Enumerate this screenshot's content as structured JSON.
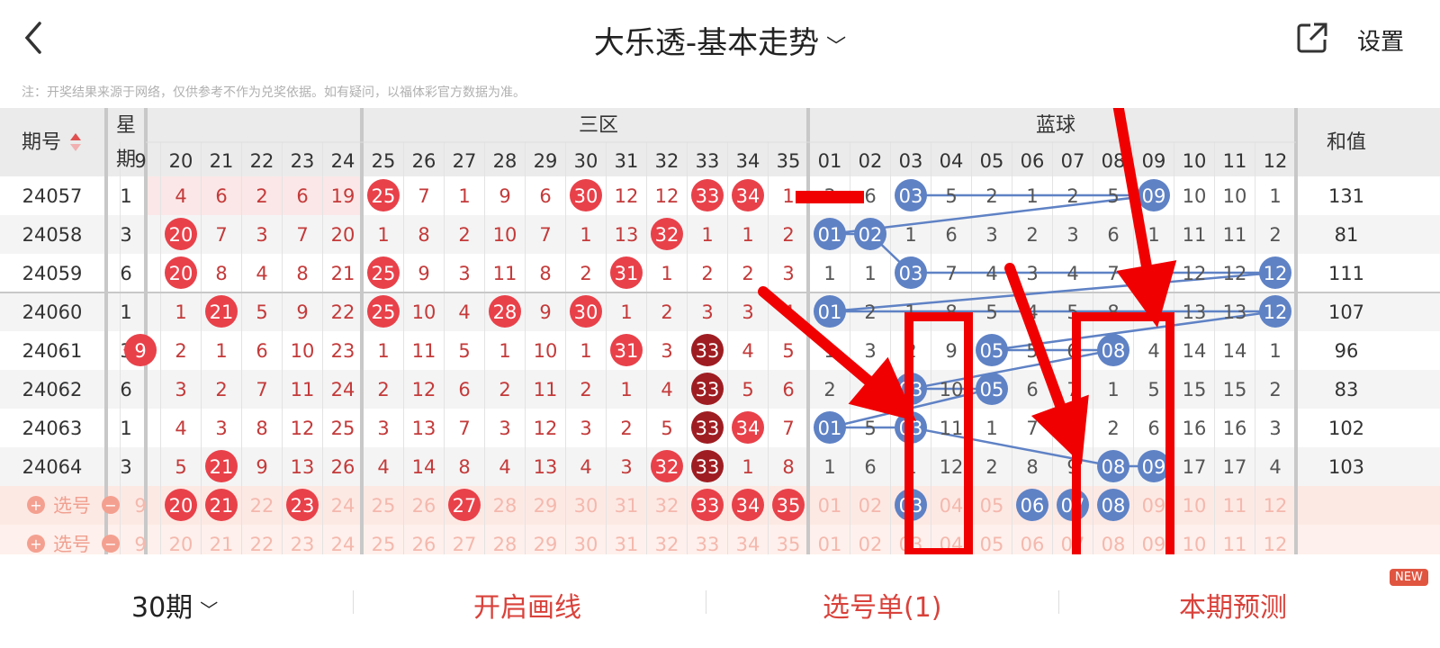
{
  "header": {
    "title": "大乐透-基本走势",
    "settings": "设置"
  },
  "note": "注：开奖结果来源于网络，仅供参考不作为兑奖依据。如有疑问，以福体彩官方数据为准。",
  "table": {
    "period_header": "期号",
    "weekday_header": "星期",
    "sanqu_header": "三区",
    "blue_header": "蓝球",
    "sum_header": "和值",
    "pick_label": "选号",
    "red_numbers": [
      "9",
      "20",
      "21",
      "22",
      "23",
      "24",
      "25",
      "26",
      "27",
      "28",
      "29",
      "30",
      "31",
      "32",
      "33",
      "34",
      "35"
    ],
    "blue_numbers": [
      "01",
      "02",
      "03",
      "04",
      "05",
      "06",
      "07",
      "08",
      "09",
      "10",
      "11",
      "12"
    ],
    "rows": [
      {
        "period": "24057",
        "week": "1",
        "red": [
          "",
          "4",
          "6",
          "2",
          "6",
          "19",
          "25",
          "7",
          "1",
          "9",
          "6",
          "30",
          "12",
          "12",
          "33",
          "34",
          "1"
        ],
        "blue": [
          "3",
          "6",
          "03",
          "5",
          "2",
          "1",
          "2",
          "5",
          "09",
          "10",
          "10",
          "1"
        ],
        "sum": "131"
      },
      {
        "period": "24058",
        "week": "3",
        "red": [
          "",
          "20",
          "7",
          "3",
          "7",
          "20",
          "1",
          "8",
          "2",
          "10",
          "7",
          "1",
          "13",
          "32",
          "1",
          "1",
          "2"
        ],
        "blue": [
          "01",
          "02",
          "1",
          "6",
          "3",
          "2",
          "3",
          "6",
          "1",
          "11",
          "11",
          "2"
        ],
        "sum": "81"
      },
      {
        "period": "24059",
        "week": "6",
        "red": [
          "",
          "20",
          "8",
          "4",
          "8",
          "21",
          "25",
          "9",
          "3",
          "11",
          "8",
          "2",
          "31",
          "1",
          "2",
          "2",
          "3"
        ],
        "blue": [
          "1",
          "1",
          "03",
          "7",
          "4",
          "3",
          "4",
          "7",
          "2",
          "12",
          "12",
          "12"
        ],
        "sum": "111"
      },
      {
        "period": "24060",
        "week": "1",
        "red": [
          "",
          "1",
          "21",
          "5",
          "9",
          "22",
          "25",
          "10",
          "4",
          "28",
          "9",
          "30",
          "1",
          "2",
          "3",
          "3",
          "4"
        ],
        "blue": [
          "01",
          "2",
          "1",
          "8",
          "5",
          "4",
          "5",
          "8",
          "3",
          "13",
          "13",
          "12"
        ],
        "sum": "107"
      },
      {
        "period": "24061",
        "week": "3",
        "red": [
          "9",
          "2",
          "1",
          "6",
          "10",
          "23",
          "1",
          "11",
          "5",
          "1",
          "10",
          "1",
          "31",
          "3",
          "33",
          "4",
          "5"
        ],
        "blue": [
          "1",
          "3",
          "2",
          "9",
          "05",
          "5",
          "6",
          "08",
          "4",
          "14",
          "14",
          "1"
        ],
        "sum": "96"
      },
      {
        "period": "24062",
        "week": "6",
        "red": [
          "",
          "3",
          "2",
          "7",
          "11",
          "24",
          "2",
          "12",
          "6",
          "2",
          "11",
          "2",
          "1",
          "4",
          "33",
          "5",
          "6"
        ],
        "blue": [
          "2",
          "4",
          "03",
          "10",
          "05",
          "6",
          "7",
          "1",
          "5",
          "15",
          "15",
          "2"
        ],
        "sum": "83"
      },
      {
        "period": "24063",
        "week": "1",
        "red": [
          "",
          "4",
          "3",
          "8",
          "12",
          "25",
          "3",
          "13",
          "7",
          "3",
          "12",
          "3",
          "2",
          "5",
          "33",
          "34",
          "7"
        ],
        "blue": [
          "01",
          "5",
          "03",
          "11",
          "1",
          "7",
          "8",
          "2",
          "6",
          "16",
          "16",
          "3"
        ],
        "sum": "102"
      },
      {
        "period": "24064",
        "week": "3",
        "red": [
          "",
          "5",
          "21",
          "9",
          "13",
          "26",
          "4",
          "14",
          "8",
          "4",
          "13",
          "4",
          "3",
          "32",
          "33",
          "1",
          "8"
        ],
        "blue": [
          "1",
          "6",
          "1",
          "12",
          "2",
          "8",
          "9",
          "08",
          "09",
          "17",
          "17",
          "4"
        ],
        "sum": "103"
      }
    ],
    "ball_cells": {
      "0": {
        "red": [
          6,
          11,
          14,
          15
        ],
        "blue": [
          2,
          8
        ]
      },
      "1": {
        "red": [
          1,
          13
        ],
        "blue": [
          0,
          1
        ]
      },
      "2": {
        "red": [
          1,
          6,
          12
        ],
        "blue": [
          2,
          11
        ]
      },
      "3": {
        "red": [
          2,
          6,
          9,
          11
        ],
        "blue": [
          0,
          11
        ]
      },
      "4": {
        "red": [
          0,
          12,
          14
        ],
        "blue": [
          4,
          7
        ]
      },
      "5": {
        "red": [
          14
        ],
        "blue": [
          2,
          4
        ]
      },
      "6": {
        "red": [
          14,
          15
        ],
        "blue": [
          0,
          2
        ]
      },
      "7": {
        "red": [
          2,
          13,
          14
        ],
        "blue": [
          7,
          8
        ]
      }
    },
    "dark_cells": {
      "4": [
        14
      ],
      "5": [
        14
      ],
      "6": [
        14
      ],
      "7": [
        14
      ]
    },
    "pick_red": [
      1,
      2,
      4,
      8,
      14,
      15,
      16
    ],
    "pick_blue": [
      2,
      5,
      6,
      7
    ]
  },
  "colors": {
    "red_ball": "#e8414a",
    "dark_ball": "#9e1d22",
    "blue_ball": "#5f82c5",
    "annotation": "#f00000",
    "red_text": "#c43a3a",
    "accent": "#d9423b"
  },
  "bottom": {
    "period_select": "30期",
    "draw_line": "开启画线",
    "pick_list": "选号单(1)",
    "predict": "本期预测",
    "new_badge": "NEW"
  }
}
